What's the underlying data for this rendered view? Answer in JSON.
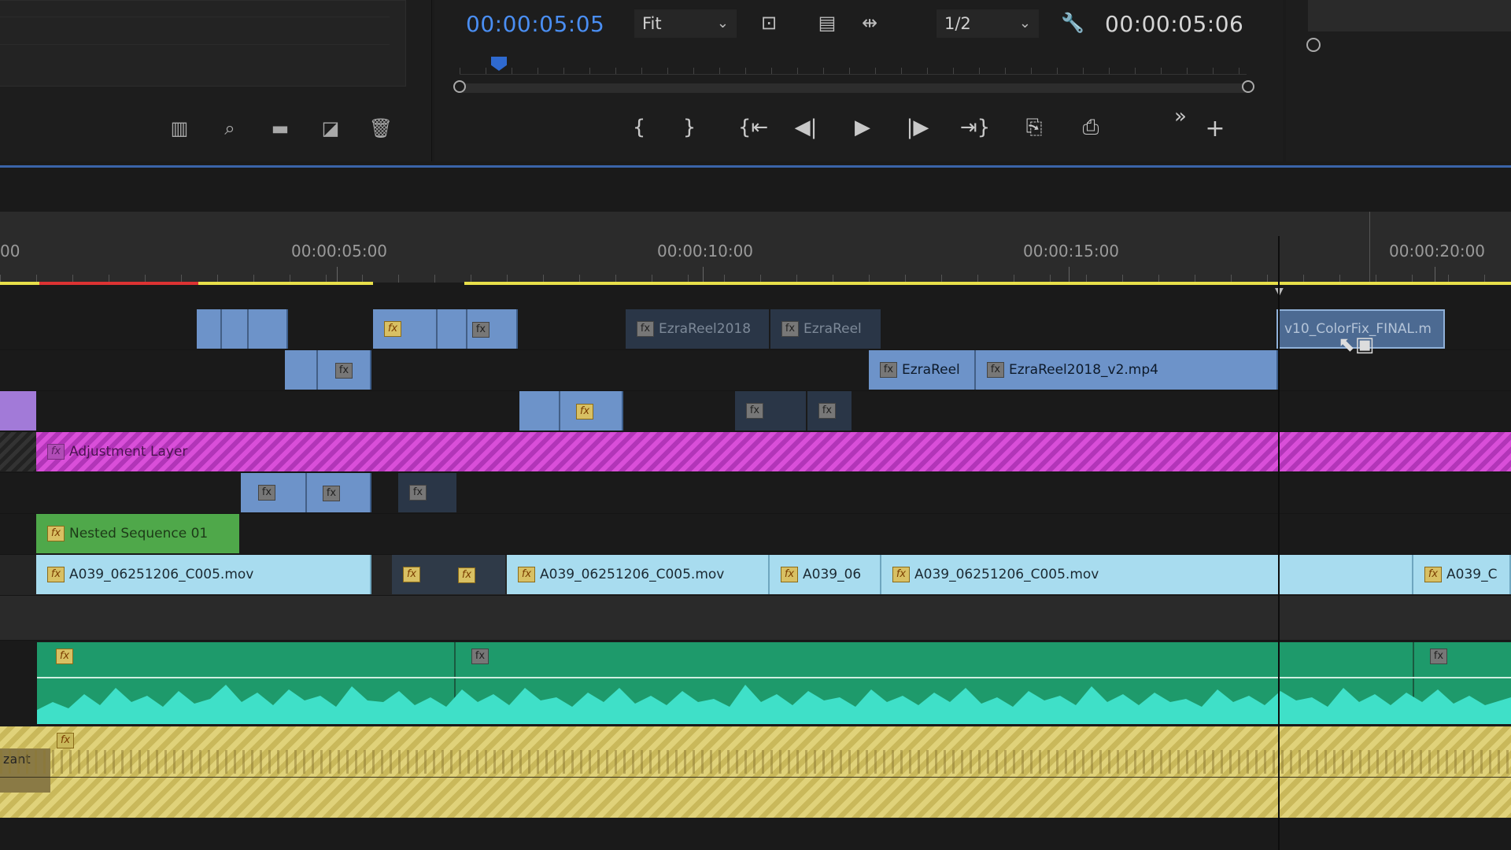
{
  "project_panel": {
    "tools": [
      {
        "icon": "bin-list-icon",
        "glyph": "▥"
      },
      {
        "icon": "search-icon",
        "glyph": "⌕"
      },
      {
        "icon": "new-bin-icon",
        "glyph": "▬"
      },
      {
        "icon": "new-item-icon",
        "glyph": "◪"
      },
      {
        "icon": "trash-icon",
        "glyph": "🗑"
      }
    ]
  },
  "monitor": {
    "current_timecode": "00:00:05:05",
    "zoom": "Fit",
    "resolution": "1/2",
    "duration_timecode": "00:00:05:06",
    "transport": {
      "mark_in": "{",
      "mark_out": "}",
      "go_to_in": "{⇤",
      "step_back": "◀|",
      "play": "▶",
      "step_forward": "|▶",
      "go_to_out": "⇥}",
      "insert": "⎘",
      "overwrite": "⎙",
      "more": "»",
      "add": "+"
    }
  },
  "timeline": {
    "ruler_labels": [
      "00",
      "00:00:05:00",
      "00:00:10:00",
      "00:00:15:00",
      "00:00:20:00"
    ],
    "clips": {
      "v6_a": "EzraReel2018",
      "v6_b": "EzraReel",
      "v6_sel": "v10_ColorFix_FINAL.m",
      "v5_a": "EzraReel",
      "v5_b": "EzraReel2018_v2.mp4",
      "adjustment": "Adjustment Layer",
      "nested": "Nested Sequence 01",
      "v1_a": "A039_06251206_C005.mov",
      "v1_b": "A039_06251206_C005.mov",
      "v1_c": "A039_06",
      "v1_d": "A039_06251206_C005.mov",
      "v1_e": "A039_C",
      "audio2_label": "zant"
    }
  },
  "colors": {
    "timecode": "#4a8ef2",
    "adjustment_layer": "#d94fd9",
    "nested_sequence": "#4fa84a",
    "audio": "#1e9a6b",
    "work_area": "#e8e04a"
  }
}
